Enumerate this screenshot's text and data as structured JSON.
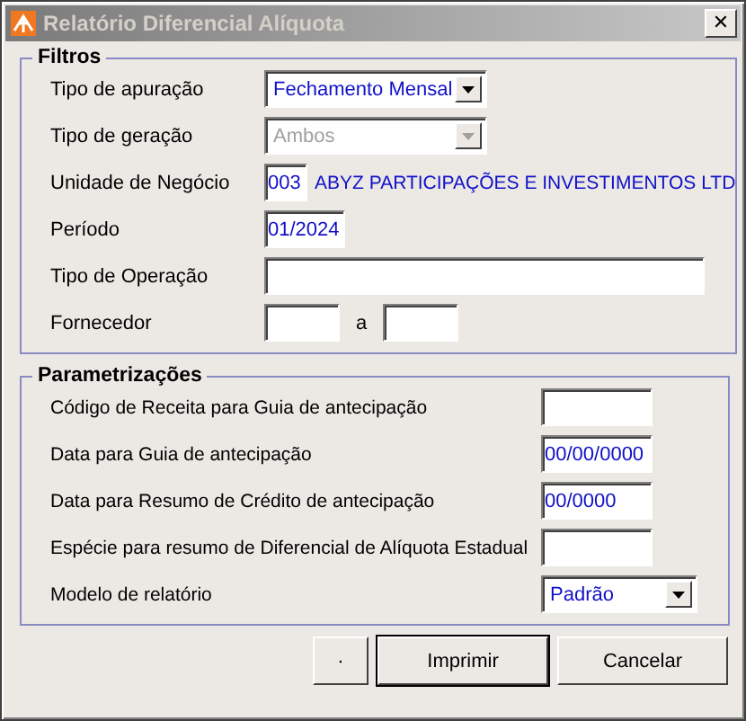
{
  "window": {
    "title": "Relatório Diferencial Alíquota",
    "close": "✕",
    "active": false
  },
  "filters": {
    "title": "Filtros",
    "rows": [
      {
        "kind": "select",
        "label": "Tipo de apuração",
        "value": "Fechamento Mensal",
        "disabled": false
      },
      {
        "kind": "select",
        "label": "Tipo de geração",
        "value": "Ambos",
        "disabled": true
      },
      {
        "kind": "lookup",
        "label": "Unidade de Negócio",
        "value": "003",
        "description": "ABYZ PARTICIPAÇÕES E INVESTIMENTOS LTD"
      },
      {
        "kind": "date",
        "label": "Período",
        "value": "01/2024"
      },
      {
        "kind": "text",
        "label": "Tipo de Operação"
      },
      {
        "kind": "range",
        "label": "Fornecedor",
        "separator": "a"
      }
    ]
  },
  "parameters": {
    "title": "Parametrizações",
    "rows": [
      {
        "kind": "text",
        "label": "Código de Receita para Guia de antecipação"
      },
      {
        "kind": "text",
        "label": "Data para Guia de antecipação",
        "value": "00/00/0000"
      },
      {
        "kind": "text",
        "label": "Data para Resumo de Crédito de antecipação",
        "value": "00/0000"
      },
      {
        "kind": "text",
        "label": "Espécie para resumo de Diferencial de Alíquota Estadual"
      },
      {
        "kind": "select",
        "label": "Modelo de relatório",
        "value": "Padrão",
        "disabled": false
      }
    ]
  },
  "buttons": [
    {
      "label": "·",
      "default": false
    },
    {
      "label": "Imprimir",
      "default": true
    },
    {
      "label": "Cancelar",
      "default": false
    }
  ]
}
